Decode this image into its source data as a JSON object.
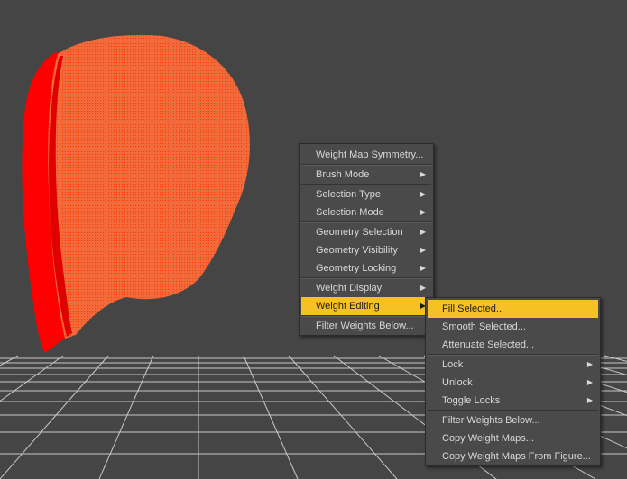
{
  "main_menu": {
    "items": [
      {
        "label": "Weight Map Symmetry...",
        "submenu": false
      },
      {
        "label": "Brush Mode",
        "submenu": true
      },
      {
        "label": "Selection Type",
        "submenu": true
      },
      {
        "label": "Selection Mode",
        "submenu": true
      },
      {
        "label": "Geometry Selection",
        "submenu": true
      },
      {
        "label": "Geometry Visibility",
        "submenu": true
      },
      {
        "label": "Geometry Locking",
        "submenu": true
      },
      {
        "label": "Weight Display",
        "submenu": true
      },
      {
        "label": "Weight Editing",
        "submenu": true,
        "highlighted": true
      },
      {
        "label": "Filter Weights Below...",
        "submenu": false
      }
    ]
  },
  "sub_menu": {
    "items": [
      {
        "label": "Fill Selected...",
        "submenu": false,
        "highlighted": true
      },
      {
        "label": "Smooth Selected...",
        "submenu": false
      },
      {
        "label": "Attenuate Selected...",
        "submenu": false
      },
      {
        "label": "Lock",
        "submenu": true
      },
      {
        "label": "Unlock",
        "submenu": true
      },
      {
        "label": "Toggle Locks",
        "submenu": true
      },
      {
        "label": "Filter Weights Below...",
        "submenu": false
      },
      {
        "label": "Copy Weight Maps...",
        "submenu": false
      },
      {
        "label": "Copy Weight Maps From Figure...",
        "submenu": false
      }
    ]
  },
  "colors": {
    "viewport_bg": "#454545",
    "grid_line": "#c8c8c8",
    "weight_red": "#ff0000",
    "weight_orange": "#f06a3c",
    "menu_bg": "#4a4a4a",
    "menu_highlight": "#f6c125",
    "menu_text": "#d8d8d8"
  },
  "icons": {
    "submenu_arrow": "▶"
  }
}
